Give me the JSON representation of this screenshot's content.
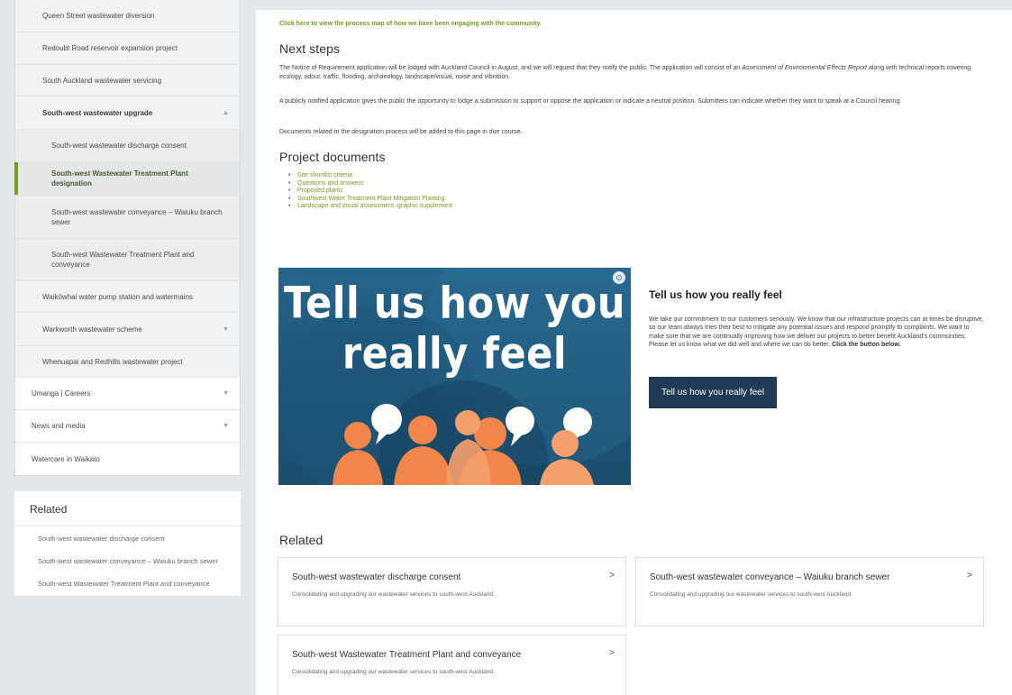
{
  "sidebar": {
    "items": [
      {
        "label": "Queen Street wastewater diversion",
        "level": 2
      },
      {
        "label": "Redoubt Road reservoir expansion project",
        "level": 2
      },
      {
        "label": "South Auckland wastewater servicing",
        "level": 2
      },
      {
        "label": "South-west wastewater upgrade",
        "level": 2,
        "caret": "▲"
      },
      {
        "label": "South-west wastewater discharge consent",
        "level": 3
      },
      {
        "label": "South-west Wastewater Treatment Plant designation",
        "level": 3
      },
      {
        "label": "South-west wastewater conveyance – Waiuku branch sewer",
        "level": 3
      },
      {
        "label": "South-west Wastewater Treatment Plant and conveyance",
        "level": 3
      },
      {
        "label": "Waikōwhai water pump station and watermains",
        "level": 2
      },
      {
        "label": "Warkworth wastewater scheme",
        "level": 2,
        "caret": "▼"
      },
      {
        "label": "Whenuapai and Redhills wastewater project",
        "level": 2
      },
      {
        "label": "Umanga | Careers",
        "level": 1,
        "caret": "▼"
      },
      {
        "label": "News and media",
        "level": 1,
        "caret": "▼"
      },
      {
        "label": "Watercare in Waikato",
        "level": 1
      }
    ],
    "related": {
      "title": "Related",
      "links": [
        "South-west wastewater discharge consent",
        "South-west wastewater conveyance – Waiuku branch sewer",
        "South-west Wastewater Treatment Plant and conveyance"
      ]
    }
  },
  "main": {
    "process_link": "Click here to view the process map of how we have been engaging with the community.",
    "next_steps": {
      "title": "Next steps",
      "p1_start": "The Notice of Requirement application will be lodged with Auckland Council in August, and we will request that they notify the public. The application will consist of an ",
      "p1_em": "Assessment of Environmental Effects Report",
      "p1_end": " along with technical reports covering ecology, odour, traffic, flooding, archaeology, landscape/visual, noise and vibration.",
      "p2": "A publicly notified application gives the public the opportunity to lodge a submission to support or oppose the application or indicate a neutral position. Submitters can indicate whether they want to speak at a Council hearing.",
      "p3": "Documents related to the designation process will be added to this page in due course."
    },
    "project_documents": {
      "title": "Project documents",
      "items": [
        "Site shortlist criteria",
        "Questions and answers",
        "Proposed plants",
        "Southwest Water Treatment Plant Mitigation Planting",
        "Landscape and visual assessment, graphic supplement"
      ]
    },
    "banner": {
      "line1": "Tell us how you",
      "line2": "really feel"
    },
    "feedback": {
      "title": "Tell us how you really feel",
      "text": "We take our commitment to our customers seriously. We know that our infrastructure projects can at times be disruptive, so our team always tries their best to mitigate any potential issues and respond promptly to complaints. We want to make sure that we are continually improving how we deliver our projects to better benefit Auckland's communities. Please let us know what we did well and where we can do better. ",
      "text_bold": "Click the button below.",
      "button": "Tell us how you really feel"
    },
    "related": {
      "title": "Related",
      "cards": [
        {
          "title": "South-west wastewater discharge consent",
          "desc": "Consolidating and upgrading our wastewater services to south-west Auckland."
        },
        {
          "title": "South-west wastewater conveyance – Waiuku branch sewer",
          "desc": "Consolidating and upgrading our wastewater services to south-west Auckland."
        },
        {
          "title": "South-west Wastewater Treatment Plant and conveyance",
          "desc": "Consolidating and upgrading our wastewater services to south-west Auckland."
        }
      ]
    }
  },
  "colors": {
    "accent_green": "#7b9a1f",
    "button_navy": "#1f3a55",
    "banner_blue": "#27658c",
    "people_orange": "#f0864a"
  }
}
